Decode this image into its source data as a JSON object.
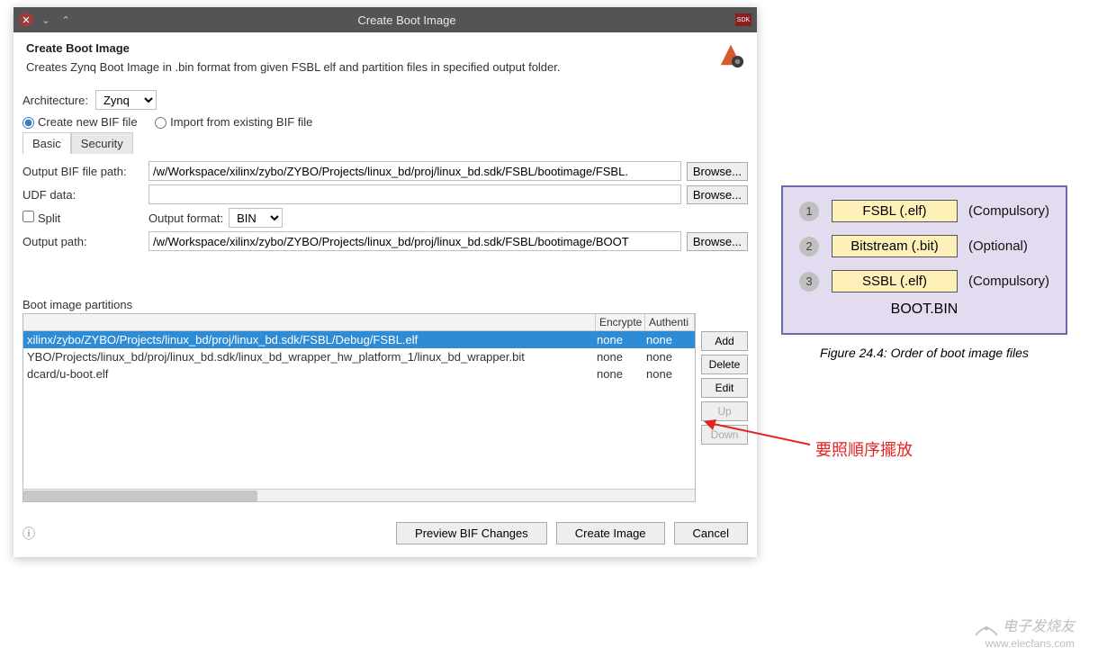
{
  "titlebar": {
    "title": "Create Boot Image",
    "sdk": "SDK"
  },
  "header": {
    "title": "Create Boot Image",
    "desc": "Creates Zynq Boot Image in .bin format from given FSBL elf and partition files in specified output folder."
  },
  "arch": {
    "label": "Architecture:",
    "value": "Zynq"
  },
  "bif": {
    "create_label": "Create new BIF file",
    "import_label": "Import from existing BIF file",
    "selected": "create"
  },
  "tabs": {
    "basic": "Basic",
    "security": "Security",
    "active": "basic"
  },
  "fields": {
    "bif_path_label": "Output BIF file path:",
    "bif_path": "/w/Workspace/xilinx/zybo/ZYBO/Projects/linux_bd/proj/linux_bd.sdk/FSBL/bootimage/FSBL.",
    "udf_label": "UDF data:",
    "udf": "",
    "split_label": "Split",
    "outfmt_label": "Output format:",
    "outfmt": "BIN",
    "outpath_label": "Output path:",
    "outpath": "/w/Workspace/xilinx/zybo/ZYBO/Projects/linux_bd/proj/linux_bd.sdk/FSBL/bootimage/BOOT",
    "browse": "Browse..."
  },
  "partitions": {
    "label": "Boot image partitions",
    "cols": {
      "file": "",
      "enc": "Encrypte",
      "auth": "Authenti"
    },
    "rows": [
      {
        "file": "xilinx/zybo/ZYBO/Projects/linux_bd/proj/linux_bd.sdk/FSBL/Debug/FSBL.elf",
        "enc": "none",
        "auth": "none",
        "sel": true
      },
      {
        "file": "YBO/Projects/linux_bd/proj/linux_bd.sdk/linux_bd_wrapper_hw_platform_1/linux_bd_wrapper.bit",
        "enc": "none",
        "auth": "none",
        "sel": false
      },
      {
        "file": "dcard/u-boot.elf",
        "enc": "none",
        "auth": "none",
        "sel": false
      }
    ],
    "buttons": {
      "add": "Add",
      "delete": "Delete",
      "edit": "Edit",
      "up": "Up",
      "down": "Down"
    }
  },
  "footer": {
    "preview": "Preview BIF Changes",
    "create": "Create Image",
    "cancel": "Cancel"
  },
  "diagram": {
    "rows": [
      {
        "n": "1",
        "box": "FSBL   (.elf)",
        "note": "(Compulsory)"
      },
      {
        "n": "2",
        "box": "Bitstream  (.bit)",
        "note": "(Optional)"
      },
      {
        "n": "3",
        "box": "SSBL   (.elf)",
        "note": "(Compulsory)"
      }
    ],
    "footer": "BOOT.BIN"
  },
  "caption": "Figure 24.4:  Order of boot image files",
  "annotation": "要照順序擺放",
  "watermark": {
    "ch": "电子发烧友",
    "url": "www.elecfans.com"
  }
}
